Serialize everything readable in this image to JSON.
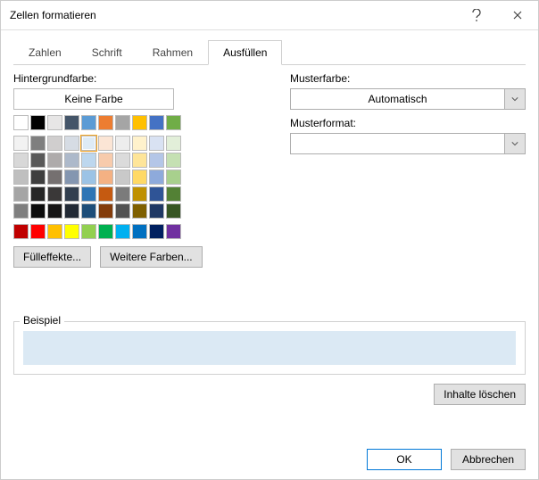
{
  "window": {
    "title": "Zellen formatieren"
  },
  "tabs": [
    "Zahlen",
    "Schrift",
    "Rahmen",
    "Ausfüllen"
  ],
  "activeTab": 3,
  "left": {
    "label": "Hintergrundfarbe:",
    "noColor": "Keine Farbe",
    "fillEffects": "Fülleffekte...",
    "moreColors": "Weitere Farben..."
  },
  "right": {
    "patternColorLabel": "Musterfarbe:",
    "patternColorValue": "Automatisch",
    "patternFormatLabel": "Musterformat:",
    "patternFormatValue": ""
  },
  "sample": {
    "label": "Beispiel",
    "color": "#dbe9f4"
  },
  "clear": "Inhalte löschen",
  "ok": "OK",
  "cancel": "Abbrechen",
  "colors": {
    "row1": [
      "#ffffff",
      "#000000",
      "#e7e6e6",
      "#445569",
      "#5b9bd5",
      "#ed7d31",
      "#a5a5a5",
      "#ffc000",
      "#4472c4",
      "#70ad47"
    ],
    "themeRows": [
      [
        "#f2f2f2",
        "#7f7f7f",
        "#d0cece",
        "#d6dce4",
        "#deebf6",
        "#fbe5d5",
        "#ededed",
        "#fff2cc",
        "#d9e2f3",
        "#e2efd9"
      ],
      [
        "#d8d8d8",
        "#595959",
        "#aeabab",
        "#adb9ca",
        "#bdd7ee",
        "#f7cbac",
        "#dbdbdb",
        "#fee599",
        "#b4c6e7",
        "#c5e0b3"
      ],
      [
        "#bfbfbf",
        "#3f3f3f",
        "#757070",
        "#8496b0",
        "#9cc3e5",
        "#f4b183",
        "#c9c9c9",
        "#ffd965",
        "#8eaadb",
        "#a8d08d"
      ],
      [
        "#a5a5a5",
        "#262626",
        "#3a3838",
        "#323f4f",
        "#2e75b5",
        "#c55a11",
        "#7b7b7b",
        "#bf9000",
        "#2f5496",
        "#538135"
      ],
      [
        "#7f7f7f",
        "#0c0c0c",
        "#171616",
        "#222a35",
        "#1e4e79",
        "#833c0b",
        "#525252",
        "#7f6000",
        "#1f3864",
        "#375623"
      ]
    ],
    "standard": [
      "#c00000",
      "#ff0000",
      "#ffc000",
      "#ffff00",
      "#92d050",
      "#00b050",
      "#00b0f0",
      "#0070c0",
      "#002060",
      "#7030a0"
    ]
  },
  "selectedColor": "#deebf6"
}
